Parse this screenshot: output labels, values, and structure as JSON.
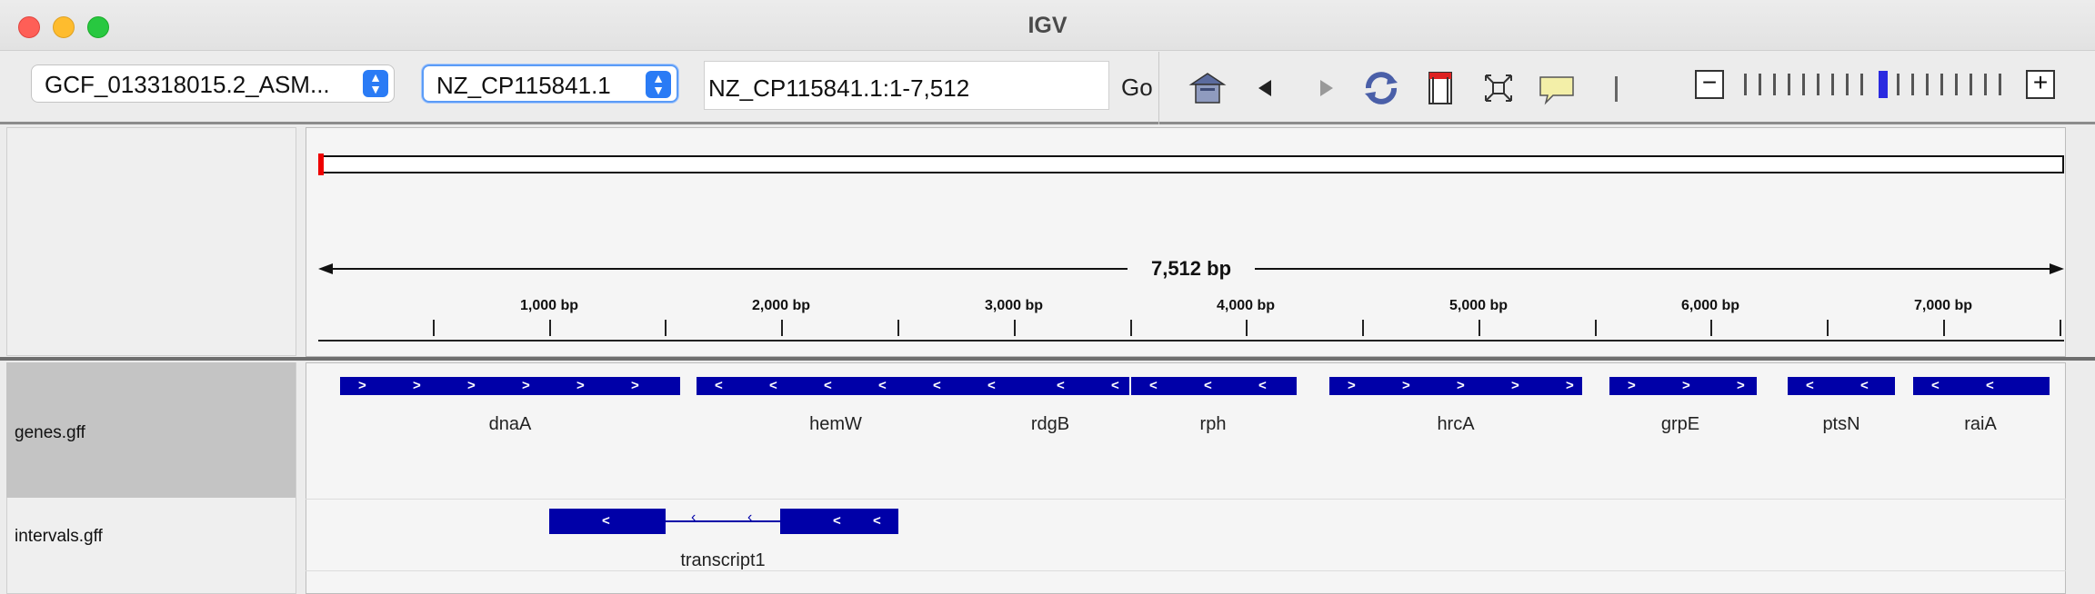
{
  "window": {
    "title": "IGV"
  },
  "toolbar": {
    "genome_select": "GCF_013318015.2_ASM...",
    "chromosome_select": "NZ_CP115841.1",
    "locus_input": "NZ_CP115841.1:1-7,512",
    "go_label": "Go",
    "icons": [
      "home-icon",
      "back-icon",
      "forward-icon",
      "refresh-icon",
      "roi-icon",
      "resize-icon",
      "popup-text-icon",
      "divider-icon"
    ],
    "zoom": {
      "minus": "−",
      "plus": "+",
      "level": 7,
      "levels": 14
    }
  },
  "ruler": {
    "span_label": "7,512 bp",
    "ticks": [
      "1,000 bp",
      "2,000 bp",
      "3,000 bp",
      "4,000 bp",
      "5,000 bp",
      "6,000 bp",
      "7,000 bp"
    ]
  },
  "tracks": {
    "genes": {
      "name": "genes.gff",
      "features": [
        {
          "name": "dnaA",
          "strand": "+"
        },
        {
          "name": "hemW",
          "strand": "-"
        },
        {
          "name": "rdgB",
          "strand": "-"
        },
        {
          "name": "rph",
          "strand": "-"
        },
        {
          "name": "hrcA",
          "strand": "+"
        },
        {
          "name": "grpE",
          "strand": "+"
        },
        {
          "name": "ptsN",
          "strand": "-"
        },
        {
          "name": "raiA",
          "strand": "-"
        }
      ]
    },
    "intervals": {
      "name": "intervals.gff",
      "features": [
        {
          "name": "transcript1",
          "strand": "-"
        }
      ]
    }
  },
  "colors": {
    "feature": "#0000a8",
    "selected_track": "#c4c4c4",
    "roi_marker": "#ee0000",
    "zoom_thumb": "#2a2ae0"
  }
}
